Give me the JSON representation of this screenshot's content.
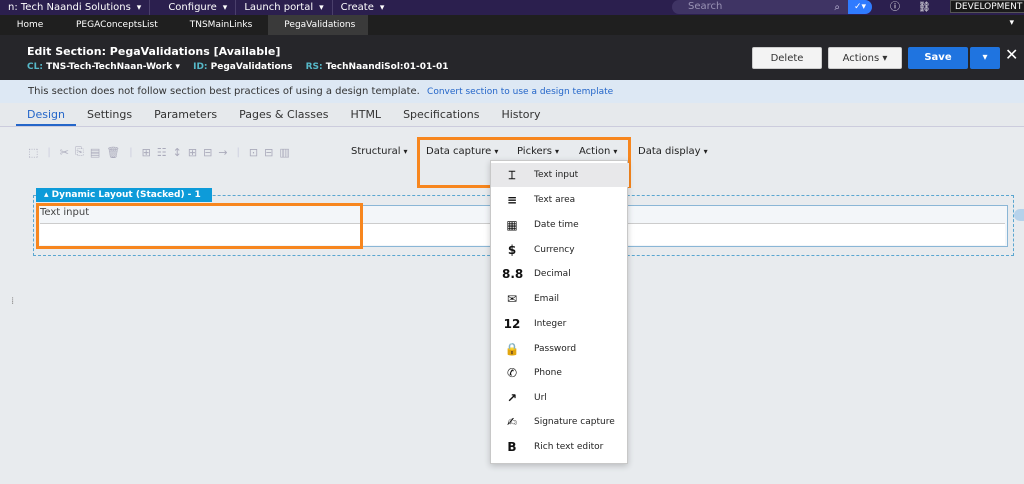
{
  "topbar": {
    "app_name": "n: Tech Naandi Solutions",
    "configure": "Configure",
    "launch_portal": "Launch portal",
    "create": "Create",
    "search_placeholder": "Search",
    "environment": "DEVELOPMENT"
  },
  "tabs": [
    {
      "label": "Home"
    },
    {
      "label": "PEGAConceptsList"
    },
    {
      "label": "TNSMainLinks"
    },
    {
      "label": "PegaValidations"
    }
  ],
  "header": {
    "title": "Edit  Section: PegaValidations [Available]",
    "cl_key": "CL:",
    "cl_value": "TNS-Tech-TechNaan-Work",
    "id_key": "ID:",
    "id_value": "PegaValidations",
    "rs_key": "RS:",
    "rs_value": "TechNaandiSol:01-01-01",
    "delete_label": "Delete",
    "actions_label": "Actions",
    "save_label": "Save"
  },
  "banner": {
    "text": "This section does not follow section best practices of using a design template.",
    "link": "Convert section to use a design template"
  },
  "designer_tabs": [
    {
      "label": "Design"
    },
    {
      "label": "Settings"
    },
    {
      "label": "Parameters"
    },
    {
      "label": "Pages & Classes"
    },
    {
      "label": "HTML"
    },
    {
      "label": "Specifications"
    },
    {
      "label": "History"
    }
  ],
  "toolbar": {
    "structural": "Structural",
    "data_capture": "Data capture",
    "pickers": "Pickers",
    "action": "Action",
    "data_display": "Data display"
  },
  "canvas": {
    "layout_label": "Dynamic Layout (Stacked) -   1",
    "field_label": "Text input"
  },
  "data_capture_menu": [
    {
      "icon": "text-input-icon",
      "glyph": "⌶",
      "label": "Text input"
    },
    {
      "icon": "text-area-icon",
      "glyph": "≡",
      "label": "Text area"
    },
    {
      "icon": "calendar-icon",
      "glyph": "▦",
      "label": "Date time"
    },
    {
      "icon": "currency-icon",
      "glyph": "$",
      "label": "Currency"
    },
    {
      "icon": "decimal-icon",
      "glyph": "8.8",
      "label": "Decimal"
    },
    {
      "icon": "email-icon",
      "glyph": "✉",
      "label": "Email"
    },
    {
      "icon": "integer-icon",
      "glyph": "12",
      "label": "Integer"
    },
    {
      "icon": "lock-icon",
      "glyph": "🔒",
      "label": "Password"
    },
    {
      "icon": "phone-icon",
      "glyph": "✆",
      "label": "Phone"
    },
    {
      "icon": "external-link-icon",
      "glyph": "↗",
      "label": "Url"
    },
    {
      "icon": "signature-icon",
      "glyph": "✍",
      "label": "Signature capture"
    },
    {
      "icon": "bold-icon",
      "glyph": "B",
      "label": "Rich text editor"
    }
  ]
}
